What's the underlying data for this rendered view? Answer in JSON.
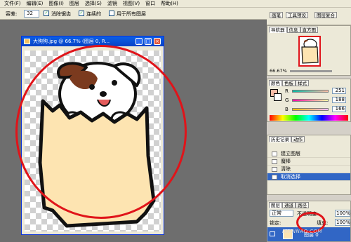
{
  "menubar": {
    "items": [
      "文件(F)",
      "编辑(E)",
      "图像(I)",
      "图层",
      "选择(S)",
      "滤镜",
      "视图(V)",
      "窗口",
      "帮助(H)"
    ]
  },
  "optionsbar": {
    "tolerance_label": "容差:",
    "tolerance_value": "32",
    "antialias_label": "消除锯齿",
    "contiguous_label": "连续的",
    "alllayers_label": "用于所有图层"
  },
  "palette_well": {
    "tabs": [
      "画笔",
      "工具预设",
      "图层复合"
    ]
  },
  "document": {
    "title": "大狗狗.jpg @ 66.7% (图层 0, R...",
    "min": "_",
    "max": "□",
    "close": "×"
  },
  "navigator": {
    "tabs": [
      "导航器",
      "信息",
      "直方图"
    ],
    "zoom": "66.67%"
  },
  "color_panel": {
    "tabs": [
      "颜色",
      "色板",
      "样式"
    ],
    "r_label": "R",
    "g_label": "G",
    "b_label": "B",
    "r_value": "251",
    "g_value": "188",
    "b_value": "166",
    "swatch": "#fbbca6"
  },
  "history_panel": {
    "tabs": [
      "历史记录",
      "动作"
    ],
    "items": [
      {
        "label": "建立图层",
        "active": false
      },
      {
        "label": "魔棒",
        "active": false
      },
      {
        "label": "清除",
        "active": false
      },
      {
        "label": "取消选择",
        "active": true
      }
    ]
  },
  "layers_panel": {
    "tabs": [
      "图层",
      "通道",
      "路径"
    ],
    "blend_mode": "正常",
    "opacity_label": "不透明度:",
    "opacity_value": "100%",
    "lock_label": "锁定:",
    "fill_label": "填充:",
    "fill_value": "100%",
    "layer_name": "图层 0"
  },
  "watermark": "DIANNAO.COM",
  "colors": {
    "highlight_ring": "#e0141a",
    "title_bar": "#0842c6",
    "selection": "#3166c5"
  }
}
